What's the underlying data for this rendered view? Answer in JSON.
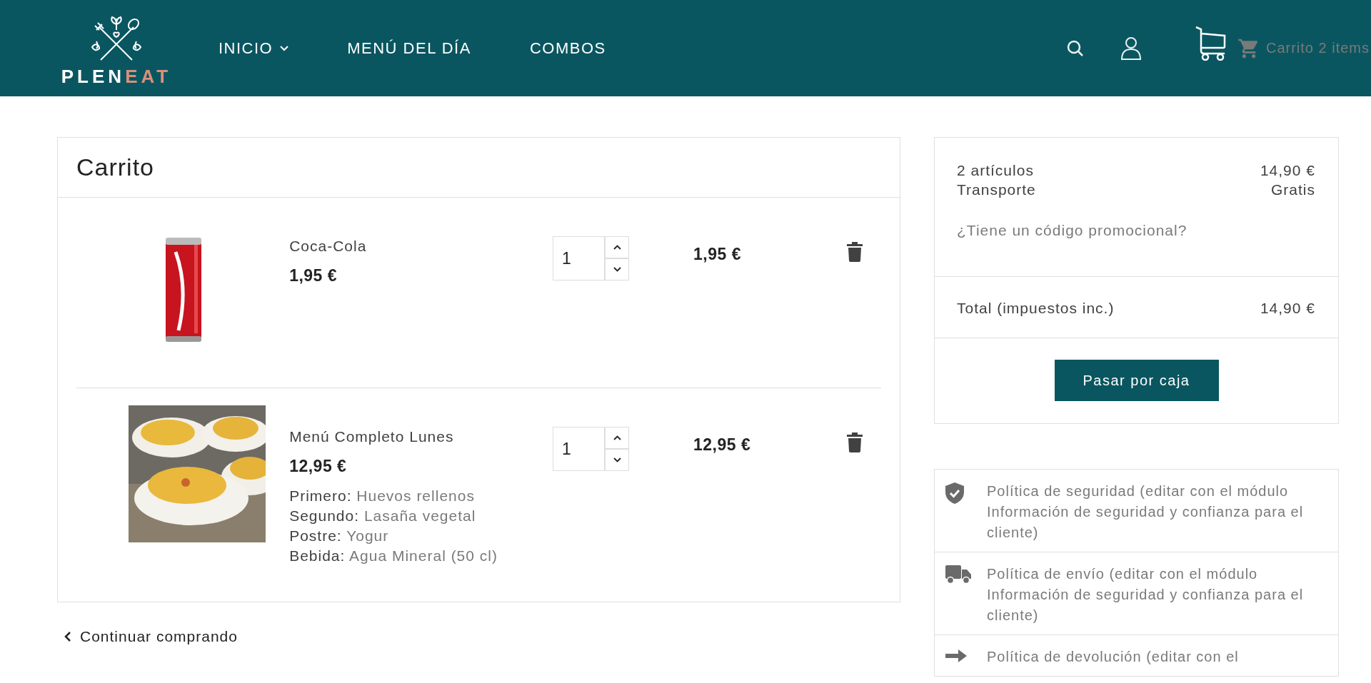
{
  "header": {
    "logo": {
      "text_main": "PLEN",
      "text_accent": "EAT"
    },
    "nav": [
      {
        "label": "INICIO",
        "dropdown": true
      },
      {
        "label": "MENÚ DEL DÍA",
        "dropdown": false
      },
      {
        "label": "COMBOS",
        "dropdown": false
      }
    ],
    "cart_link": "Carrito 2 items"
  },
  "cart": {
    "title": "Carrito",
    "items": [
      {
        "name": "Coca-Cola",
        "unit_price": "1,95 €",
        "quantity": "1",
        "total": "1,95 €"
      },
      {
        "name": "Menú Completo Lunes",
        "unit_price": "12,95 €",
        "quantity": "1",
        "total": "12,95 €",
        "details": [
          {
            "label": "Primero:",
            "value": "Huevos rellenos"
          },
          {
            "label": "Segundo:",
            "value": "Lasaña vegetal"
          },
          {
            "label": "Postre:",
            "value": "Yogur"
          },
          {
            "label": "Bebida:",
            "value": "Agua Mineral (50 cl)"
          }
        ]
      }
    ],
    "continue_link": "Continuar comprando"
  },
  "summary": {
    "lines": [
      {
        "label": "2 artículos",
        "value": "14,90 €"
      },
      {
        "label": "Transporte",
        "value": "Gratis"
      }
    ],
    "promo_link": "¿Tiene un código promocional?",
    "total": {
      "label": "Total (impuestos inc.)",
      "value": "14,90 €"
    },
    "checkout_button": "Pasar por caja"
  },
  "reassurance": [
    {
      "kind": "shield",
      "text": "Política de seguridad (editar con el módulo Información de seguridad y confianza para el cliente)"
    },
    {
      "kind": "truck",
      "text": "Política de envío (editar con el módulo Información de seguridad y confianza para el cliente)"
    },
    {
      "kind": "arrow",
      "text": "Política de devolución (editar con el"
    }
  ]
}
